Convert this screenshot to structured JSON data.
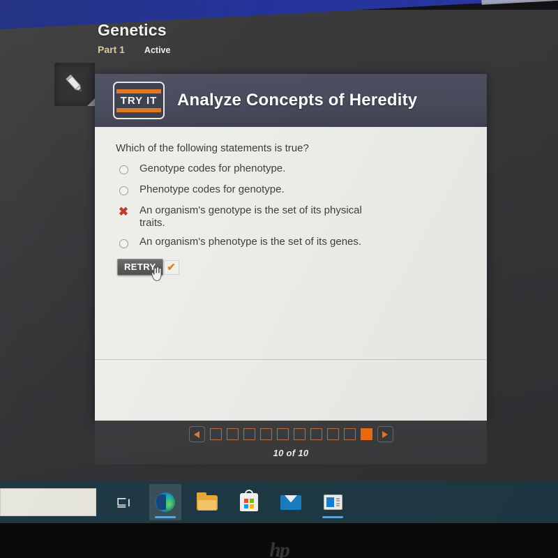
{
  "lesson": {
    "title": "Genetics",
    "part": "Part 1",
    "status": "Active"
  },
  "tools": {
    "pencil_icon": "pencil-icon"
  },
  "activity": {
    "badge_text": "TRY IT",
    "title": "Analyze Concepts of Heredity"
  },
  "question": {
    "prompt": "Which of the following statements is true?",
    "choices": [
      {
        "marker": "radio-empty",
        "label": "Genotype codes for phenotype."
      },
      {
        "marker": "radio-empty",
        "label": "Phenotype codes for genotype."
      },
      {
        "marker": "incorrect-x",
        "label": "An organism's genotype is the set of its physical traits."
      },
      {
        "marker": "radio-empty",
        "label": "An organism's phenotype is the set of its genes."
      }
    ],
    "retry_label": "RETRY",
    "check_glyph": "✔",
    "cursor_icon": "hand-pointer-cursor"
  },
  "pager": {
    "prev_label": "◀",
    "next_label": "▶",
    "total_pages": 10,
    "current_page": 10,
    "count_label": "10 of 10",
    "accent_color": "#ee6d12",
    "outline_color": "#c0703a"
  },
  "taskbar": {
    "search_placeholder": "",
    "items": [
      {
        "icon": "task-view-icon",
        "label": "Task View",
        "glyph": "⊑ı",
        "active": false
      },
      {
        "icon": "microsoft-edge-icon",
        "label": "Microsoft Edge",
        "active": true
      },
      {
        "icon": "file-explorer-icon",
        "label": "File Explorer",
        "active": false
      },
      {
        "icon": "microsoft-store-icon",
        "label": "Microsoft Store",
        "active": false
      },
      {
        "icon": "mail-icon",
        "label": "Mail",
        "active": false
      },
      {
        "icon": "document-app-icon",
        "label": "Document App",
        "active": true
      }
    ]
  },
  "device": {
    "brand_logo": "hp"
  }
}
